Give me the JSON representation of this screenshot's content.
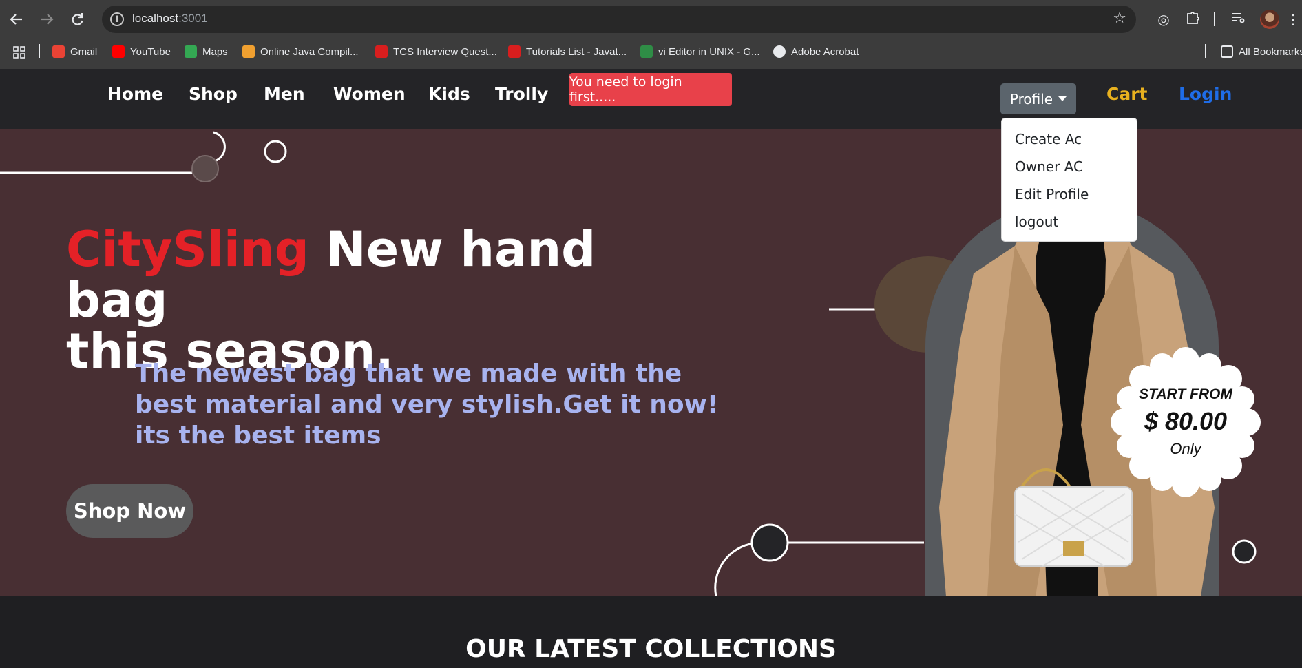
{
  "browser": {
    "url_host": "localhost",
    "url_port": ":3001",
    "bookmarks": [
      {
        "label": "Gmail",
        "color": "#ea4335"
      },
      {
        "label": "YouTube",
        "color": "#ff0000"
      },
      {
        "label": "Maps",
        "color": "#34a853"
      },
      {
        "label": "Online Java Compil...",
        "color": "#f0a030"
      },
      {
        "label": "TCS Interview Quest...",
        "color": "#d81e1e"
      },
      {
        "label": "Tutorials List - Javat...",
        "color": "#d81e1e"
      },
      {
        "label": "vi Editor in UNIX - G...",
        "color": "#2f8d46"
      },
      {
        "label": "Adobe Acrobat",
        "color": "#e8eaed"
      }
    ],
    "all_bookmarks": "All Bookmarks"
  },
  "nav": {
    "links": [
      "Home",
      "Shop",
      "Men",
      "Women",
      "Kids",
      "Trolly"
    ],
    "toast": "You need to login first.....",
    "profile": "Profile",
    "cart": "Cart",
    "login": "Login"
  },
  "dropdown": {
    "items": [
      "Create Ac",
      "Owner AC",
      "Edit Profile",
      "logout"
    ]
  },
  "hero": {
    "brand": "CitySling",
    "headline_rest": " New hand bag",
    "headline_line2": "this season.",
    "subtext": "The newest bag that we made with the best material and very stylish.Get it now! its the best items",
    "cta": "Shop Now",
    "badge": {
      "line1": "START FROM",
      "price": "$ 80.00",
      "line3": "Only"
    }
  },
  "section": {
    "title": "OUR LATEST COLLECTIONS"
  },
  "colors": {
    "hero_bg": "#482f33",
    "brand_red": "#e42127",
    "subtext": "#a8b3ef",
    "cart": "#e8b11f",
    "login": "#1f6de8",
    "toast": "#e8414a"
  }
}
